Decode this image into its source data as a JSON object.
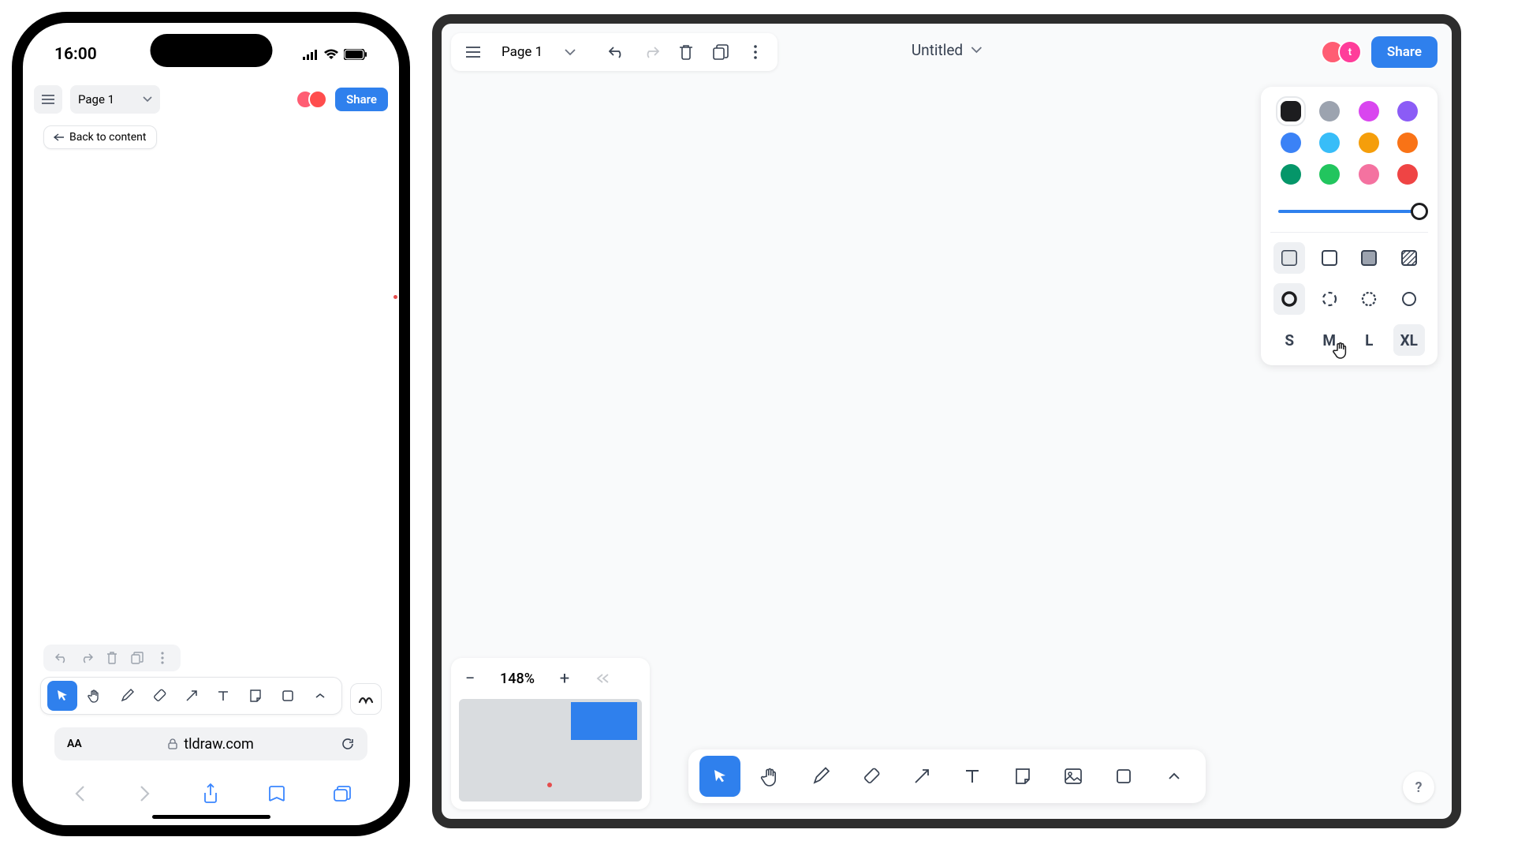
{
  "phone": {
    "status_time": "16:00",
    "page_label": "Page 1",
    "share_label": "Share",
    "back_label": "Back to content",
    "url": "tldraw.com",
    "aA": "AA"
  },
  "app": {
    "page_label": "Page 1",
    "title": "Untitled",
    "share_label": "Share",
    "zoom_value": "148%",
    "help": "?",
    "sizes": {
      "s": "S",
      "m": "M",
      "l": "L",
      "xl": "XL"
    },
    "colors": {
      "black": "#1d1d1f",
      "grey": "#9ca3af",
      "violet": "#d946ef",
      "purple": "#8b5cf6",
      "blue": "#3b82f6",
      "lightblue": "#38bdf8",
      "yellow": "#f59e0b",
      "orange": "#f97316",
      "teal": "#059669",
      "green": "#22c55e",
      "pink": "#f472a0",
      "red": "#ef4444"
    },
    "avatar_letter": "t"
  }
}
